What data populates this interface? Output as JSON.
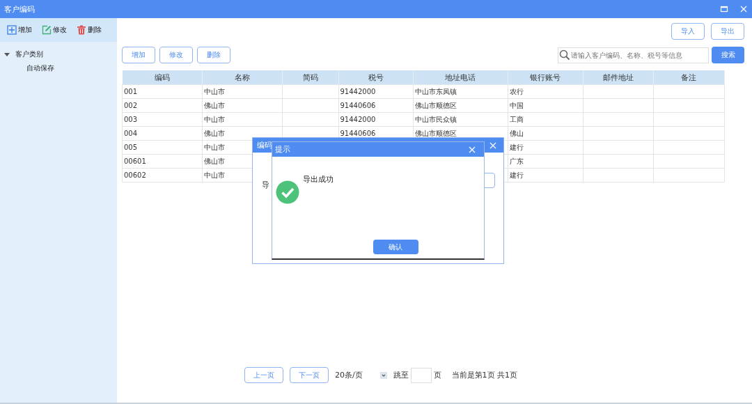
{
  "window": {
    "title": "客户编码"
  },
  "sidebar": {
    "toolbar": [
      {
        "kind": "add",
        "label": "增加"
      },
      {
        "kind": "edit",
        "label": "修改"
      },
      {
        "kind": "delete",
        "label": "删除"
      }
    ],
    "tree": [
      {
        "label": "客户类别",
        "expanded": true,
        "children": [
          {
            "label": "自动保存"
          }
        ]
      }
    ]
  },
  "main": {
    "top_buttons": [
      "导入",
      "导出"
    ],
    "actions": [
      "增加",
      "修改",
      "删除"
    ],
    "search": {
      "placeholder": "请输入客户编码、名称、税号等信息",
      "button": "搜索"
    },
    "table": {
      "columns": [
        "编码",
        "名称",
        "简码",
        "税号",
        "地址电话",
        "银行账号",
        "邮件地址",
        "备注"
      ],
      "rows": [
        [
          "001",
          "中山市",
          "",
          "91442000",
          "中山市东凤镇",
          "农行",
          "",
          ""
        ],
        [
          "002",
          "佛山市",
          "",
          "91440606",
          "佛山市顺德区",
          "中国",
          "",
          ""
        ],
        [
          "003",
          "中山市",
          "",
          "91442000",
          "中山市民众镇",
          "工商",
          "",
          ""
        ],
        [
          "004",
          "佛山市",
          "",
          "91440606",
          "佛山市顺德区",
          "佛山",
          "",
          ""
        ],
        [
          "005",
          "中山市",
          "",
          "",
          "",
          "建行",
          "",
          ""
        ],
        [
          "00601",
          "佛山市",
          "",
          "",
          "",
          "广东",
          "",
          ""
        ],
        [
          "00602",
          "中山市",
          "",
          "",
          "",
          "建行",
          "",
          ""
        ]
      ]
    },
    "pagination": {
      "prev": "上一页",
      "next": "下一页",
      "page_size": "20条/页",
      "jump_label": "跳至",
      "page_suffix": "页",
      "status": "当前是第1页 共1页"
    }
  },
  "back_dialog": {
    "title": "编码",
    "label": "导"
  },
  "alert": {
    "title": "提示",
    "message": "导出成功",
    "button": "确认"
  }
}
